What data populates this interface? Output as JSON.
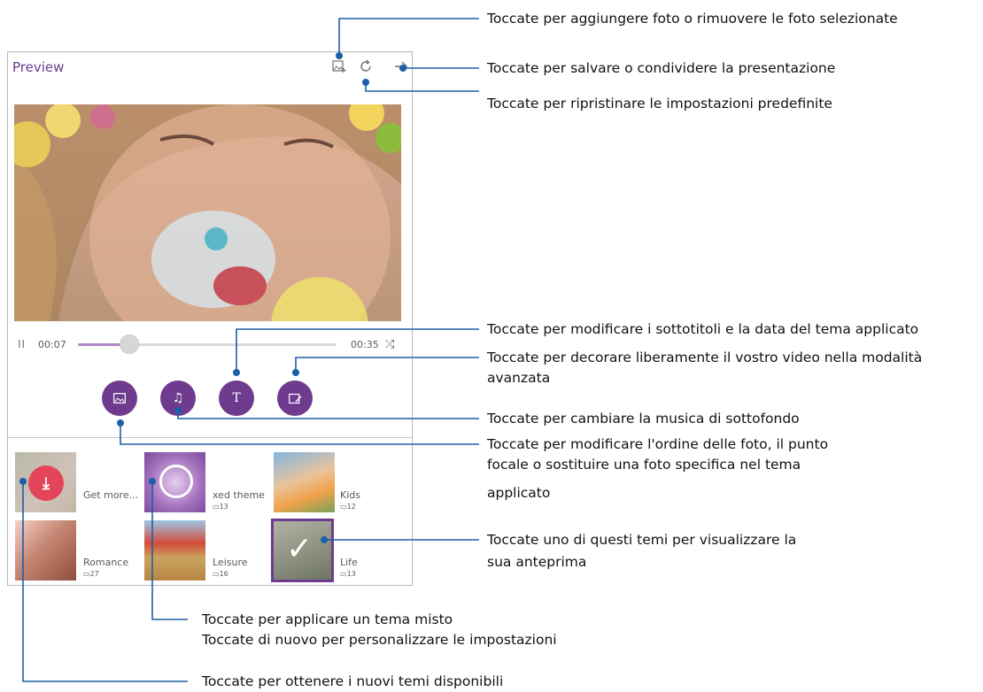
{
  "app": {
    "title": "Preview",
    "toolbar": {
      "add_photo_icon": "photo-add-icon",
      "reset_icon": "reset-icon",
      "next_icon": "arrow-right-icon"
    }
  },
  "player": {
    "pause_glyph": "II",
    "time_current": "00:07",
    "time_total": "00:35",
    "shuffle_glyph": "⤮",
    "progress_fraction": 0.2
  },
  "tools": {
    "photos_glyph": "▭",
    "music_glyph": "♫",
    "text_glyph": "T",
    "advanced_glyph": "▣"
  },
  "themes": [
    {
      "name": "Get more...",
      "count": ""
    },
    {
      "name": "xed theme",
      "count": "13"
    },
    {
      "name": "Kids",
      "count": "12"
    },
    {
      "name": "Romance",
      "count": "27"
    },
    {
      "name": "Leisure",
      "count": "16"
    },
    {
      "name": "Life",
      "count": "13"
    }
  ],
  "download_glyph": "⤓",
  "check_glyph": "✓",
  "callouts": {
    "add_photos": "Toccate per aggiungere foto o rimuovere le foto selezionate",
    "save_share": "Toccate per salvare o condividere la presentazione",
    "reset": "Toccate per ripristinare le impostazioni predefinite",
    "subtitles_1": "Toccate per modificare i sottotitoli e la data del tema applicato",
    "decorate_1": "Toccate per decorare liberamente il vostro video nella modalità",
    "decorate_2": "avanzata",
    "music": "Toccate per cambiare la musica di sottofondo",
    "order_1": "Toccate per modificare l'ordine delle foto, il punto",
    "order_2": "focale o sostituire una foto specifica nel tema",
    "order_3": "applicato",
    "theme_1": "Toccate uno di questi temi per visualizzare la",
    "theme_2": "sua anteprima",
    "mixed_1": "Toccate per applicare un tema misto",
    "mixed_2": "Toccate di nuovo per personalizzare le impostazioni",
    "get_new": "Toccate per ottenere i nuovi temi disponibili"
  },
  "colors": {
    "accent_purple": "#6f3b8e",
    "callout_line": "#1d5fa8",
    "download_red": "#e5455a"
  }
}
